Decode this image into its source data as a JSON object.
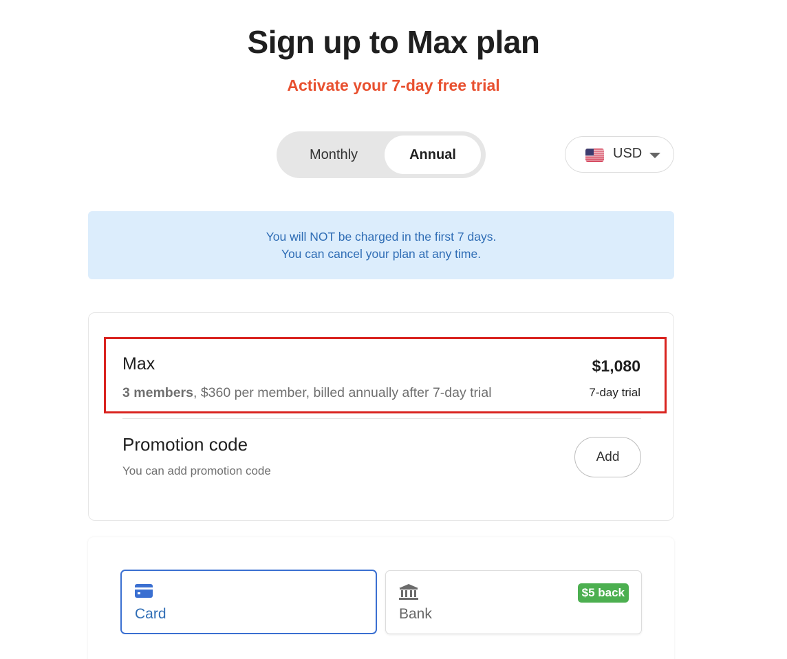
{
  "header": {
    "title": "Sign up to Max plan",
    "subtitle": "Activate your 7-day free trial",
    "subtitle_color": "#e8502f"
  },
  "billing_toggle": {
    "options": [
      "Monthly",
      "Annual"
    ],
    "selected": "Annual"
  },
  "currency": {
    "value": "USD",
    "flag_icon": "us-flag-icon"
  },
  "info_banner": {
    "line1": "You will NOT be charged in the first 7 days.",
    "line2": "You can cancel your plan at any time."
  },
  "plan": {
    "name": "Max",
    "members": "3 members",
    "details": ", $360 per member, billed annually after 7-day trial",
    "price": "$1,080",
    "trial": "7-day trial"
  },
  "promotion": {
    "title": "Promotion code",
    "description": "You can add promotion code",
    "add_label": "Add"
  },
  "payment": {
    "methods": [
      {
        "label": "Card",
        "icon": "credit-card-icon",
        "selected": true
      },
      {
        "label": "Bank",
        "icon": "bank-icon",
        "selected": false,
        "badge": "$5 back"
      }
    ],
    "accent_color": "#3a6fd1",
    "badge_color": "#4caf50"
  }
}
